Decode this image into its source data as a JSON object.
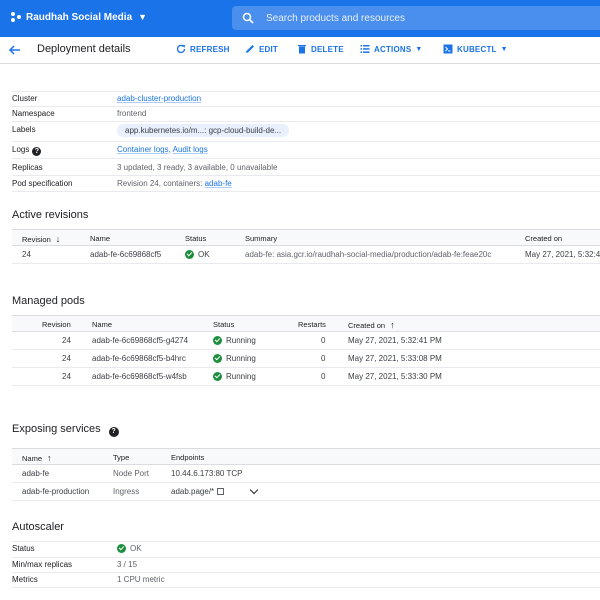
{
  "header": {
    "project_name": "Raudhah Social Media",
    "search_placeholder": "Search products and resources"
  },
  "subheader": {
    "title": "Deployment details",
    "actions": [
      "REFRESH",
      "EDIT",
      "DELETE",
      "ACTIONS",
      "KUBECTL"
    ]
  },
  "details": {
    "cluster_label": "Cluster",
    "cluster_value": "adab-cluster-production",
    "namespace_label": "Namespace",
    "namespace_value": "frontend",
    "labels_label": "Labels",
    "labels_chips": [
      "app.kubernetes.io/m...: gcp-cloud-build-de..."
    ],
    "logs_label": "Logs",
    "logs_container": "Container logs",
    "logs_sep": ", ",
    "logs_audit": "Audit logs",
    "replicas_label": "Replicas",
    "replicas_value": "3 updated, 3 ready, 3 available, 0 unavailable",
    "pod_spec_label": "Pod specification",
    "pod_spec_prefix": "Revision 24, containers: ",
    "pod_spec_link": "adab-fe"
  },
  "active_revisions": {
    "title": "Active revisions",
    "columns": [
      "Revision",
      "Name",
      "Status",
      "Summary",
      "Created on"
    ],
    "rows": [
      {
        "revision": "24",
        "name": "adab-fe-6c69868cf5",
        "status": "OK",
        "summary": "adab-fe: asia.gcr.io/raudhah-social-media/production/adab-fe:feae20c",
        "created": "May 27, 2021, 5:32:4"
      }
    ]
  },
  "managed_pods": {
    "title": "Managed pods",
    "columns": [
      "Revision",
      "Name",
      "Status",
      "Restarts",
      "Created on"
    ],
    "rows": [
      {
        "revision": "24",
        "name": "adab-fe-6c69868cf5-g4274",
        "status": "Running",
        "restarts": "0",
        "created": "May 27, 2021, 5:32:41 PM"
      },
      {
        "revision": "24",
        "name": "adab-fe-6c69868cf5-b4hrc",
        "status": "Running",
        "restarts": "0",
        "created": "May 27, 2021, 5:33:08 PM"
      },
      {
        "revision": "24",
        "name": "adab-fe-6c69868cf5-w4fsb",
        "status": "Running",
        "restarts": "0",
        "created": "May 27, 2021, 5:33:30 PM"
      }
    ]
  },
  "exposing_services": {
    "title": "Exposing services",
    "columns": [
      "Name",
      "Type",
      "Endpoints"
    ],
    "rows": [
      {
        "name": "adab-fe",
        "type": "Node Port",
        "endpoints": "10.44.6.173:80 TCP"
      },
      {
        "name": "adab-fe-production",
        "type": "Ingress",
        "endpoints": "adab.page/*"
      }
    ]
  },
  "autoscaler": {
    "title": "Autoscaler",
    "status_label": "Status",
    "status_value": "OK",
    "minmax_label": "Min/max replicas",
    "minmax_value": "3 / 15",
    "metrics_label": "Metrics",
    "metrics_value": "1 CPU metric"
  },
  "colors": {
    "brand": "#1a73e8",
    "ok_green": "#1e8e3e"
  }
}
